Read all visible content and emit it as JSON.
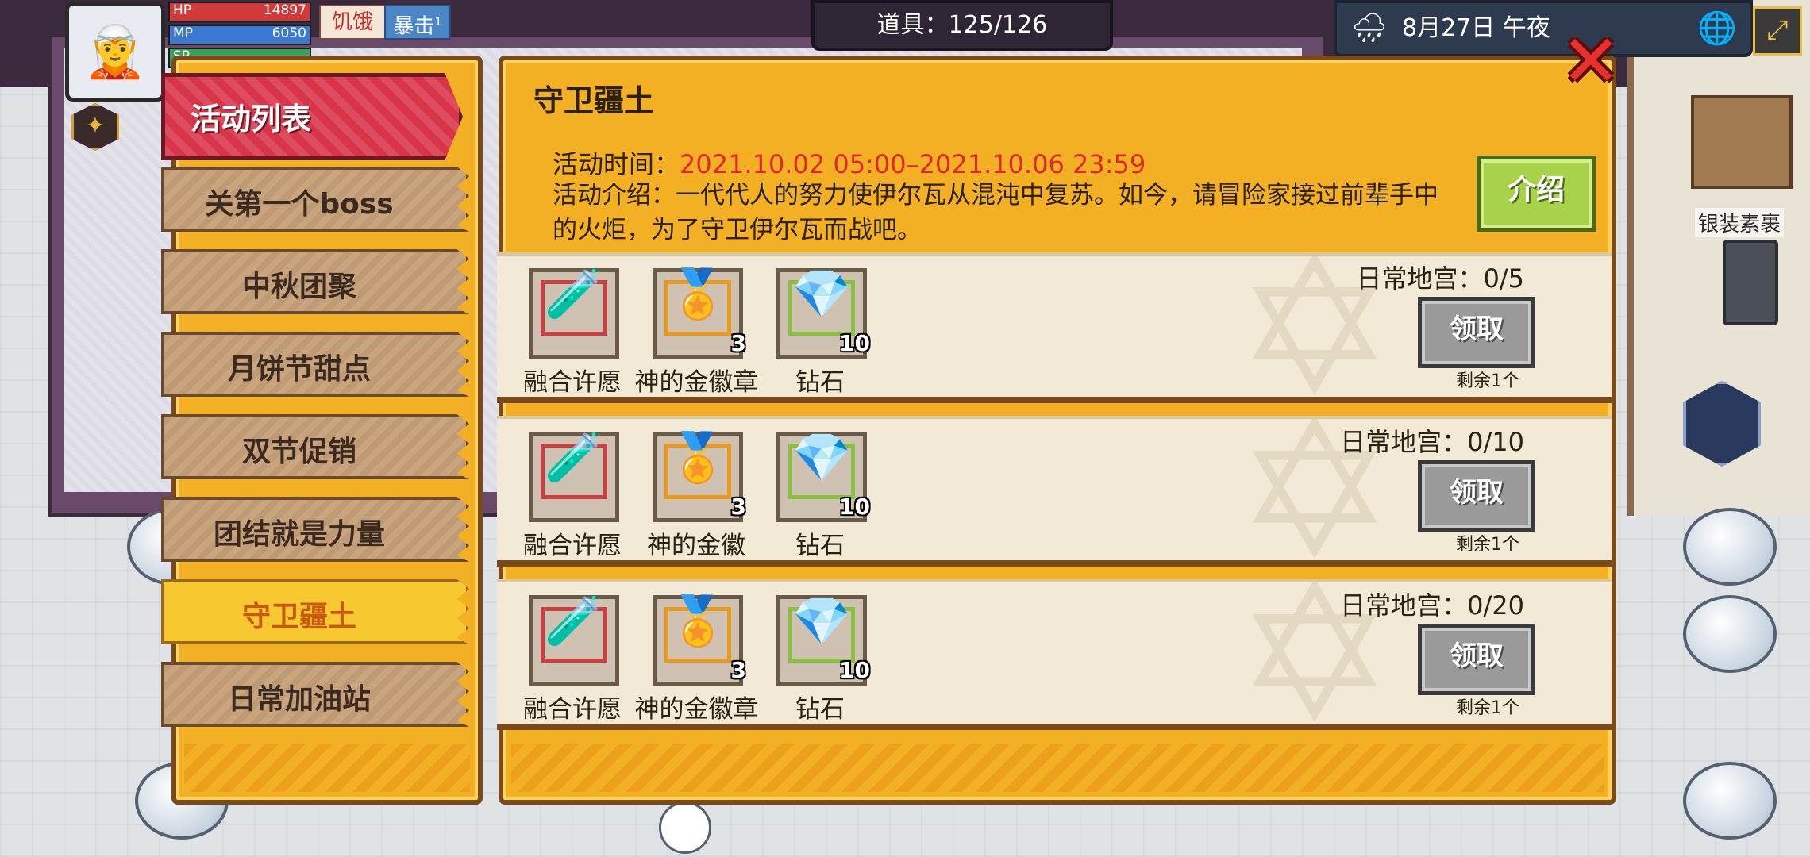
{
  "hud": {
    "avatar_icon": "🧝",
    "hp_label": "HP",
    "hp_value": "14897",
    "mp_label": "MP",
    "mp_value": "6050",
    "sp_label": "SP",
    "sp_value": "",
    "status_hunger": "饥饿",
    "status_crit": "暴击",
    "status_crit_count": "1",
    "items_counter": "道具：125/126",
    "weather_icon": "🌧",
    "date_time": "8月27日 午夜",
    "globe_icon": "🌐",
    "corner_icon": "⤢",
    "mini_icon": "✦"
  },
  "world": {
    "side_label": "银装素裹"
  },
  "sidebar": {
    "header": "活动列表",
    "tabs": [
      {
        "label": "关第一个boss",
        "selected": false
      },
      {
        "label": "中秋团聚",
        "selected": false
      },
      {
        "label": "月饼节甜点",
        "selected": false
      },
      {
        "label": "双节促销",
        "selected": false
      },
      {
        "label": "团结就是力量",
        "selected": false
      },
      {
        "label": "守卫疆土",
        "selected": true
      },
      {
        "label": "日常加油站",
        "selected": false
      }
    ]
  },
  "event": {
    "title": "守卫疆土",
    "time_label": "活动时间：",
    "time_value": "2021.10.02 05:00–2021.10.06 23:59",
    "desc_label": "活动介绍：",
    "desc_text": "一代代人的努力使伊尔瓦从混沌中复苏。如今，请冒险家接过前辈手中的火炬，为了守卫伊尔瓦而战吧。",
    "intro_button": "介绍"
  },
  "rewards": [
    {
      "progress": "日常地宫：0/5",
      "claim": "领取",
      "remain": "剩余1个",
      "items": [
        {
          "name": "融合许愿",
          "icon": "bottle-icon",
          "glyph": "🧪",
          "qty": "",
          "border": "#c84040"
        },
        {
          "name": "神的金徽章",
          "icon": "gold-badge-icon",
          "glyph": "🏅",
          "qty": "3",
          "border": "#e89a20"
        },
        {
          "name": "钻石",
          "icon": "diamond-icon",
          "glyph": "💎",
          "qty": "10",
          "border": "#8ac040"
        }
      ]
    },
    {
      "progress": "日常地宫：0/10",
      "claim": "领取",
      "remain": "剩余1个",
      "items": [
        {
          "name": "融合许愿",
          "icon": "bottle-icon",
          "glyph": "🧪",
          "qty": "",
          "border": "#c84040"
        },
        {
          "name": "神的金徽",
          "icon": "gold-badge-icon",
          "glyph": "🏅",
          "qty": "3",
          "border": "#e89a20"
        },
        {
          "name": "钻石",
          "icon": "diamond-icon",
          "glyph": "💎",
          "qty": "10",
          "border": "#8ac040"
        }
      ]
    },
    {
      "progress": "日常地宫：0/20",
      "claim": "领取",
      "remain": "剩余1个",
      "items": [
        {
          "name": "融合许愿",
          "icon": "bottle-icon",
          "glyph": "🧪",
          "qty": "",
          "border": "#c84040"
        },
        {
          "name": "神的金徽章",
          "icon": "gold-badge-icon",
          "glyph": "🏅",
          "qty": "3",
          "border": "#e89a20"
        },
        {
          "name": "钻石",
          "icon": "diamond-icon",
          "glyph": "💎",
          "qty": "10",
          "border": "#8ac040"
        }
      ]
    }
  ],
  "close_icon": "✕"
}
